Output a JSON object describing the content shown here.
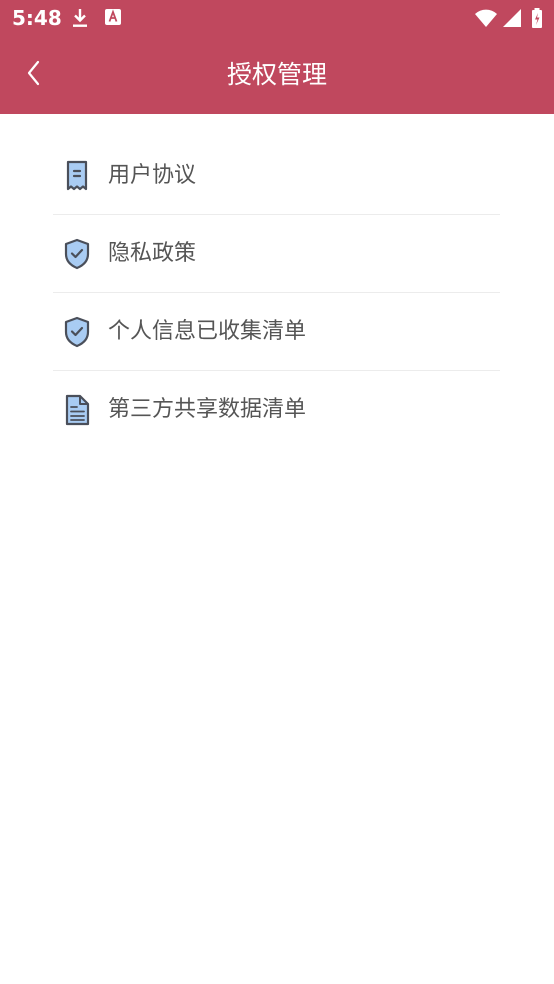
{
  "status_bar": {
    "time": "5:48",
    "left_icons": [
      "download-icon",
      "a-notification-icon"
    ],
    "right_icons": [
      "wifi-icon",
      "signal-icon",
      "battery-charging-icon"
    ]
  },
  "app_bar": {
    "title": "授权管理",
    "back_icon": "chevron-left-icon"
  },
  "menu": {
    "items": [
      {
        "label": "用户协议",
        "icon": "document-icon"
      },
      {
        "label": "隐私政策",
        "icon": "shield-check-icon"
      },
      {
        "label": "个人信息已收集清单",
        "icon": "shield-check-icon"
      },
      {
        "label": "第三方共享数据清单",
        "icon": "file-text-icon"
      }
    ]
  },
  "colors": {
    "header": "#c0485e",
    "icon_fill": "#a9ccf3",
    "icon_stroke": "#4a4f5a",
    "text": "#555555",
    "divider": "#ececec"
  }
}
